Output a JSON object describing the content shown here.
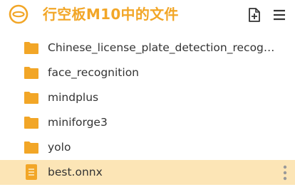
{
  "header": {
    "title": "行空板M10中的文件",
    "logo_icon": "disc-logo-icon",
    "new_file_icon": "new-file-icon",
    "menu_icon": "hamburger-menu-icon"
  },
  "colors": {
    "accent": "#F2A627",
    "selected_row": "#FCE5B6",
    "text": "#333333",
    "icon_gray": "#999999"
  },
  "files": [
    {
      "name": "Chinese_license_plate_detection_recogniti...",
      "type": "folder"
    },
    {
      "name": "face_recognition",
      "type": "folder"
    },
    {
      "name": "mindplus",
      "type": "folder"
    },
    {
      "name": "miniforge3",
      "type": "folder"
    },
    {
      "name": "yolo",
      "type": "folder"
    },
    {
      "name": "best.onnx",
      "type": "file",
      "selected": true
    }
  ]
}
